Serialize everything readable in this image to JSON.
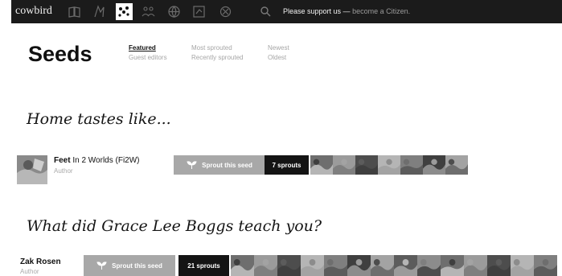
{
  "nav": {
    "logo": "cowbird",
    "icons": [
      "book-icon",
      "rider-icon",
      "seeds-icon",
      "crowd-icon",
      "globe-icon",
      "map-icon",
      "stars-icon",
      "search-icon"
    ],
    "support_text": "Please support us —",
    "support_link": "become a Citizen."
  },
  "page": {
    "title": "Seeds",
    "filters": [
      "Featured",
      "Most sprouted",
      "Newest",
      "Guest editors",
      "Recently sprouted",
      "Oldest"
    ],
    "active_filter": "Featured"
  },
  "seeds": [
    {
      "question": "Home tastes like...",
      "author": "Feet",
      "author_suffix": "In 2 Worlds (Fi2W)",
      "role": "Author",
      "sprout_label": "Sprout this seed",
      "count_label": "7 sprouts"
    },
    {
      "question": "What did Grace Lee Boggs teach you?",
      "author": "Zak Rosen",
      "author_suffix": "",
      "role": "Author",
      "sprout_label": "Sprout this seed",
      "count_label": "21 sprouts"
    }
  ],
  "colors": {
    "topbar": "#1b1b1b",
    "sprout_button": "#a8a8a8",
    "count_badge": "#141414",
    "muted_text": "#a6a6a6"
  }
}
